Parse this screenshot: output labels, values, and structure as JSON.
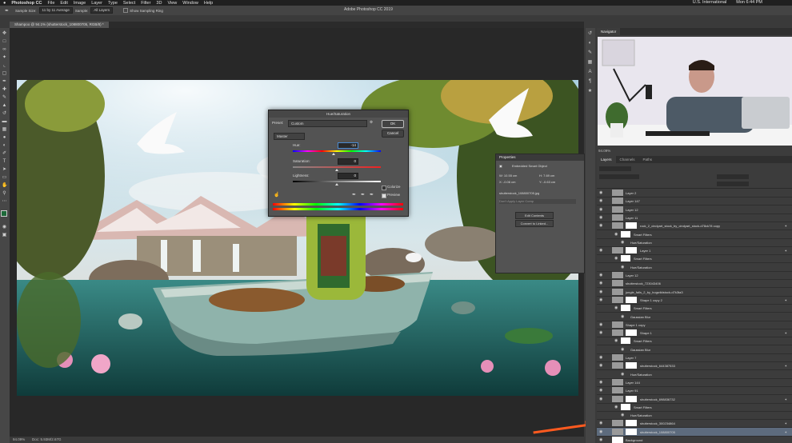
{
  "menubar": {
    "apple": "",
    "items": [
      "Photoshop CC",
      "File",
      "Edit",
      "Image",
      "Layer",
      "Type",
      "Select",
      "Filter",
      "3D",
      "View",
      "Window",
      "Help"
    ],
    "right": [
      "U.S. International",
      "Mon 6:44 PM"
    ]
  },
  "app_title": "Adobe Photoshop CC 2019",
  "options": {
    "sample_size_label": "Sample Size:",
    "sample_size_value": "11 by 11 Average",
    "sample_label": "Sample:",
    "sample_value": "All Layers",
    "show_ring": "Show Sampling Ring"
  },
  "document_tab": "Shampoo @ 94.1% (shutterstock_108800705, RGB/8) *",
  "status_bar": {
    "zoom": "94.09%",
    "doc": "Doc: 5.93M/2.67G"
  },
  "navigator": {
    "tab_navigator": "Navigator",
    "zoom": "94.09%"
  },
  "layers_panel": {
    "tabs": [
      "Layers",
      "Channels",
      "Paths"
    ],
    "rows": [
      {
        "name": "Layer 2",
        "type": "layer",
        "fx": false
      },
      {
        "name": "Layer 147",
        "type": "layer",
        "fx": false
      },
      {
        "name": "Layer 12",
        "type": "layer",
        "fx": false
      },
      {
        "name": "Layer 11",
        "type": "layer",
        "fx": false
      },
      {
        "name": "rock_2_cindyart_stock_by_cindyart_stock-d78ck78 copy",
        "type": "smart",
        "fx": true
      },
      {
        "name": "Smart Filters",
        "type": "filter",
        "fx": false
      },
      {
        "name": "Hue/Saturation",
        "type": "subfilter",
        "fx": false
      },
      {
        "name": "Layer 1",
        "type": "smart",
        "fx": true
      },
      {
        "name": "Smart Filters",
        "type": "filter",
        "fx": false
      },
      {
        "name": "Hue/Saturation",
        "type": "subfilter",
        "fx": false
      },
      {
        "name": "Layer 12",
        "type": "group",
        "fx": false
      },
      {
        "name": "shutterstock_723043406",
        "type": "layer",
        "fx": false
      },
      {
        "name": "jungle_falls_2_by_hogwildstock-d7k3ta3",
        "type": "layer",
        "fx": false
      },
      {
        "name": "Shape 1 copy 2",
        "type": "smart",
        "fx": true
      },
      {
        "name": "Smart Filters",
        "type": "filter",
        "fx": false
      },
      {
        "name": "Gaussian Blur",
        "type": "subfilter",
        "fx": false
      },
      {
        "name": "Shape 1 copy",
        "type": "layer",
        "fx": false
      },
      {
        "name": "Shape 1",
        "type": "smart",
        "fx": true
      },
      {
        "name": "Smart Filters",
        "type": "filter",
        "fx": false
      },
      {
        "name": "Gaussian Blur",
        "type": "subfilter",
        "fx": false
      },
      {
        "name": "Layer 7",
        "type": "layer",
        "fx": false
      },
      {
        "name": "shutterstock_644387533",
        "type": "smart",
        "fx": true
      },
      {
        "name": "Hue/Saturation",
        "type": "subfilter",
        "fx": false
      },
      {
        "name": "Layer 144",
        "type": "layer",
        "fx": false
      },
      {
        "name": "Layer 91",
        "type": "layer",
        "fx": false
      },
      {
        "name": "shutterstock_698836732",
        "type": "smart",
        "fx": true
      },
      {
        "name": "Smart Filters",
        "type": "filter",
        "fx": false
      },
      {
        "name": "Hue/Saturation",
        "type": "subfilter",
        "fx": false
      },
      {
        "name": "shutterstock_300234864",
        "type": "smart",
        "fx": true
      },
      {
        "name": "shutterstock_108800705",
        "type": "selected",
        "fx": true
      },
      {
        "name": "Background",
        "type": "background",
        "fx": false
      }
    ]
  },
  "properties": {
    "title": "Properties",
    "subtitle": "Embedded Smart Object",
    "w": "W: 10.55 cm",
    "h": "H: 7.69 cm",
    "x": "X: -0.06 cm",
    "y": "Y: -0.63 cm",
    "file": "shutterstock_108800705.jpg",
    "comp_placeholder": "Don't Apply Layer Comp",
    "edit_btn": "Edit Contents",
    "convert_btn": "Convert to Linked..."
  },
  "dialog": {
    "title": "Hue/Saturation",
    "preset_label": "Preset:",
    "preset_value": "Custom",
    "channel": "Master",
    "hue_label": "Hue:",
    "hue_value": "-14",
    "hue_pos": 0.46,
    "sat_label": "Saturation:",
    "sat_value": "0",
    "sat_pos": 0.5,
    "light_label": "Lightness:",
    "light_value": "0",
    "light_pos": 0.5,
    "ok": "OK",
    "cancel": "Cancel",
    "colorize": "Colorize",
    "preview": "Preview"
  },
  "colors": {
    "arrow": "#ff5a1f",
    "selected_row": "#5d6b7d"
  }
}
